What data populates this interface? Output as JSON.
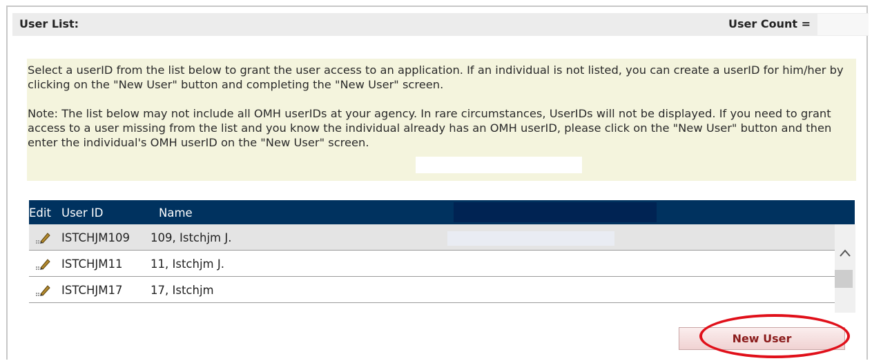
{
  "header": {
    "title": "User List:",
    "count_label": "User Count ="
  },
  "notice": {
    "paragraph1": "Select a userID from the list below to grant the user access to an application. If an individual is not listed, you can create a userID for him/her by clicking on the \"New User\" button and completing the \"New User\" screen.",
    "paragraph2": "Note:  The list below may not include all OMH userIDs at your agency.  In rare circumstances, UserIDs will not be displayed.  If you need to grant access to a user missing from the list and you know the individual already has an OMH userID, please click on the \"New User\" button and then enter the individual's OMH userID on the \"New User\" screen."
  },
  "table": {
    "columns": [
      "Edit",
      "User ID",
      "Name"
    ],
    "rows": [
      {
        "user_id": "ISTCHJM109",
        "name": "109, Istchjm J.",
        "selected": true
      },
      {
        "user_id": "ISTCHJM11",
        "name": "11, Istchjm J.",
        "selected": false
      },
      {
        "user_id": "ISTCHJM17",
        "name": "17, Istchjm",
        "selected": false
      }
    ],
    "edit_icon": "pencil-icon"
  },
  "buttons": {
    "new_user": "New User"
  },
  "colors": {
    "table_header": "#00325f",
    "notice_background": "#f4f4dd",
    "highlight_ring": "#e0101a",
    "button_text": "#8b1c1c"
  }
}
